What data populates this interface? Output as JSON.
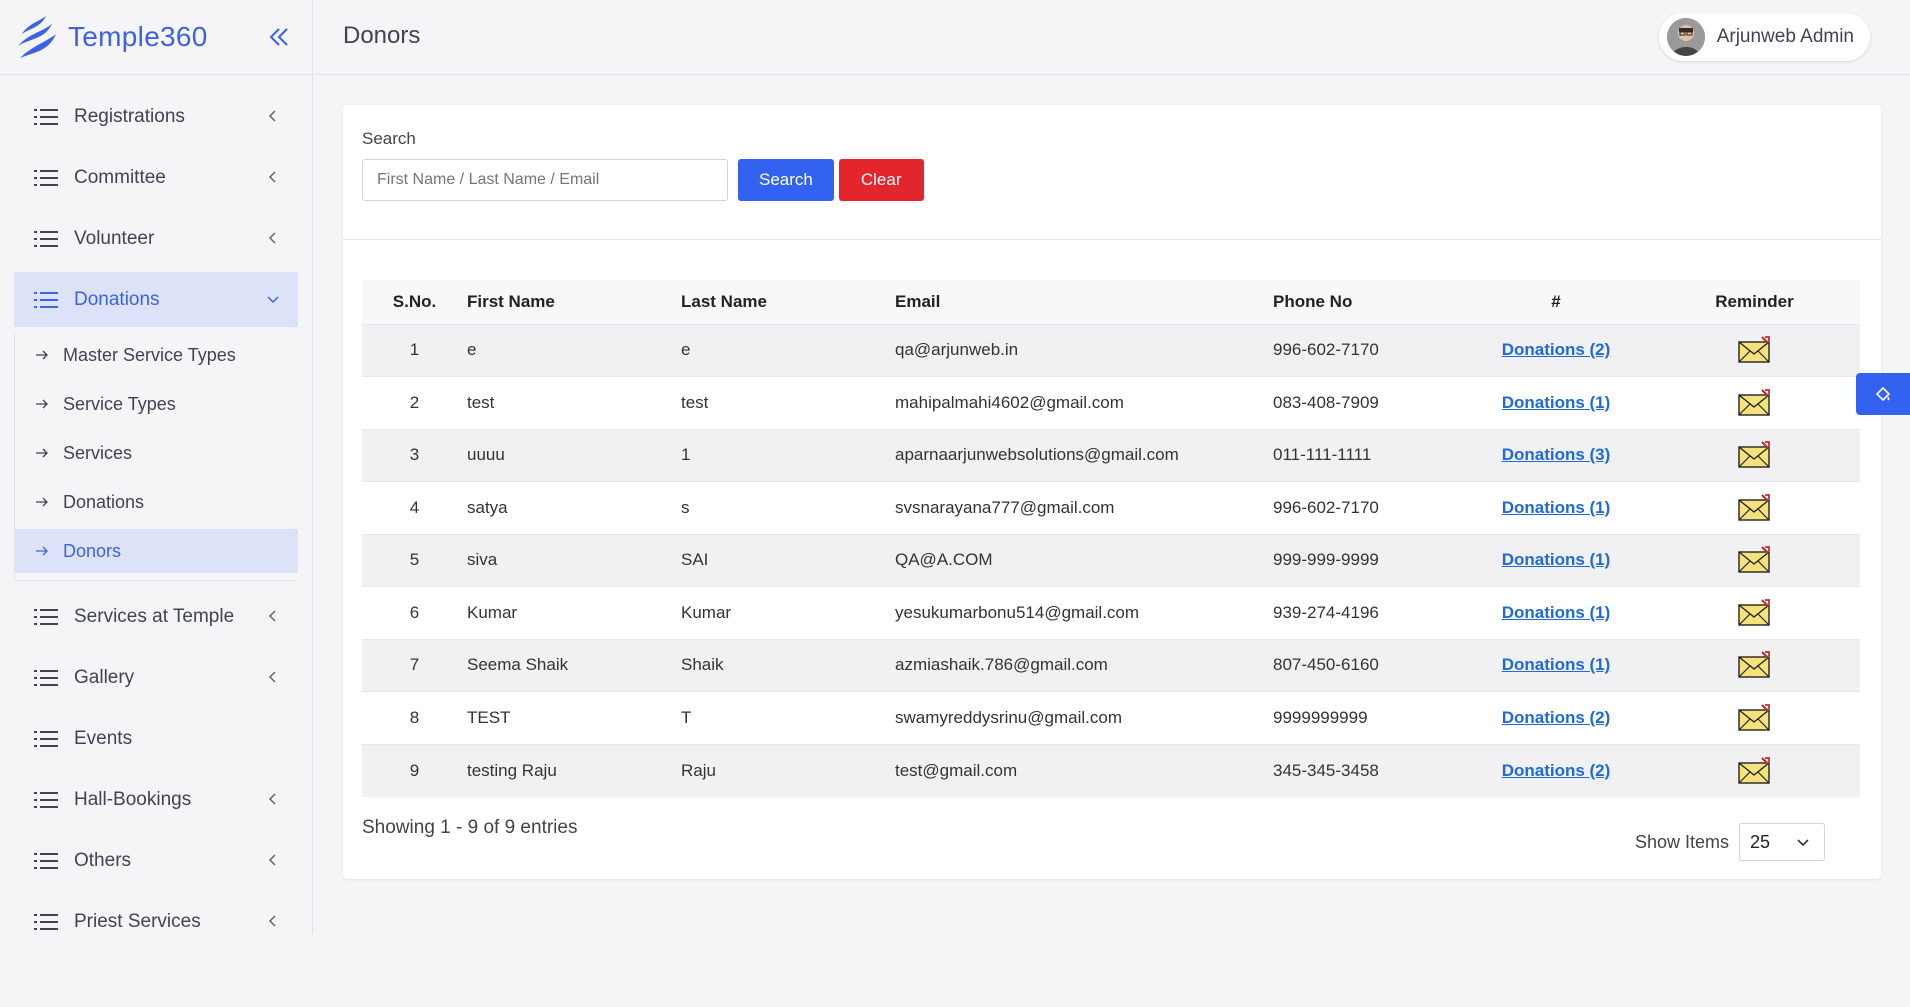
{
  "app": {
    "name": "Temple360"
  },
  "header": {
    "page_title": "Donors",
    "user_name": "Arjunweb Admin"
  },
  "sidebar": {
    "items": [
      {
        "label": "Registrations",
        "has_chevron": true
      },
      {
        "label": "Committee",
        "has_chevron": true
      },
      {
        "label": "Volunteer",
        "has_chevron": true
      },
      {
        "label": "Donations",
        "has_chevron": true,
        "expanded": true
      },
      {
        "label": "Services at Temple",
        "has_chevron": true
      },
      {
        "label": "Gallery",
        "has_chevron": true
      },
      {
        "label": "Events",
        "has_chevron": false
      },
      {
        "label": "Hall-Bookings",
        "has_chevron": true
      },
      {
        "label": "Others",
        "has_chevron": true
      },
      {
        "label": "Priest Services",
        "has_chevron": true
      }
    ],
    "donations_sub": [
      {
        "label": "Master Service Types"
      },
      {
        "label": "Service Types"
      },
      {
        "label": "Services"
      },
      {
        "label": "Donations"
      },
      {
        "label": "Donors",
        "active": true
      }
    ]
  },
  "search": {
    "label": "Search",
    "placeholder": "First Name / Last Name / Email",
    "search_button": "Search",
    "clear_button": "Clear"
  },
  "table": {
    "headers": [
      "S.No.",
      "First Name",
      "Last Name",
      "Email",
      "Phone No",
      "#",
      "Reminder"
    ],
    "rows": [
      {
        "sno": "1",
        "first": "e",
        "last": "e",
        "email": "qa@arjunweb.in",
        "phone": "996-602-7170",
        "donations": "Donations (2)"
      },
      {
        "sno": "2",
        "first": "test",
        "last": "test",
        "email": "mahipalmahi4602@gmail.com",
        "phone": "083-408-7909",
        "donations": "Donations (1)"
      },
      {
        "sno": "3",
        "first": "uuuu",
        "last": "1",
        "email": "aparnaarjunwebsolutions@gmail.com",
        "phone": "011-111-1111",
        "donations": "Donations (3)"
      },
      {
        "sno": "4",
        "first": "satya",
        "last": "s",
        "email": "svsnarayana777@gmail.com",
        "phone": "996-602-7170",
        "donations": "Donations (1)"
      },
      {
        "sno": "5",
        "first": "siva",
        "last": "SAI",
        "email": "QA@A.COM",
        "phone": "999-999-9999",
        "donations": "Donations (1)"
      },
      {
        "sno": "6",
        "first": "Kumar",
        "last": "Kumar",
        "email": "yesukumarbonu514@gmail.com",
        "phone": "939-274-4196",
        "donations": "Donations (1)"
      },
      {
        "sno": "7",
        "first": "Seema Shaik",
        "last": "Shaik",
        "email": "azmiashaik.786@gmail.com",
        "phone": "807-450-6160",
        "donations": "Donations (1)"
      },
      {
        "sno": "8",
        "first": "TEST",
        "last": "T",
        "email": "swamyreddysrinu@gmail.com",
        "phone": "9999999999",
        "donations": "Donations (2)"
      },
      {
        "sno": "9",
        "first": "testing Raju",
        "last": "Raju",
        "email": "test@gmail.com",
        "phone": "345-345-3458",
        "donations": "Donations (2)"
      }
    ]
  },
  "footer": {
    "entries_text": "Showing 1 - 9 of 9 entries",
    "show_items_label": "Show Items",
    "show_items_value": "25"
  },
  "colors": {
    "primary": "#3462f0",
    "danger": "#e3262c",
    "link": "#1f6ad8",
    "active_bg": "#dce3f9"
  },
  "icons": {
    "reminder": "envelope-icon",
    "menu": "list-icon",
    "floating": "paint-bucket-icon"
  }
}
